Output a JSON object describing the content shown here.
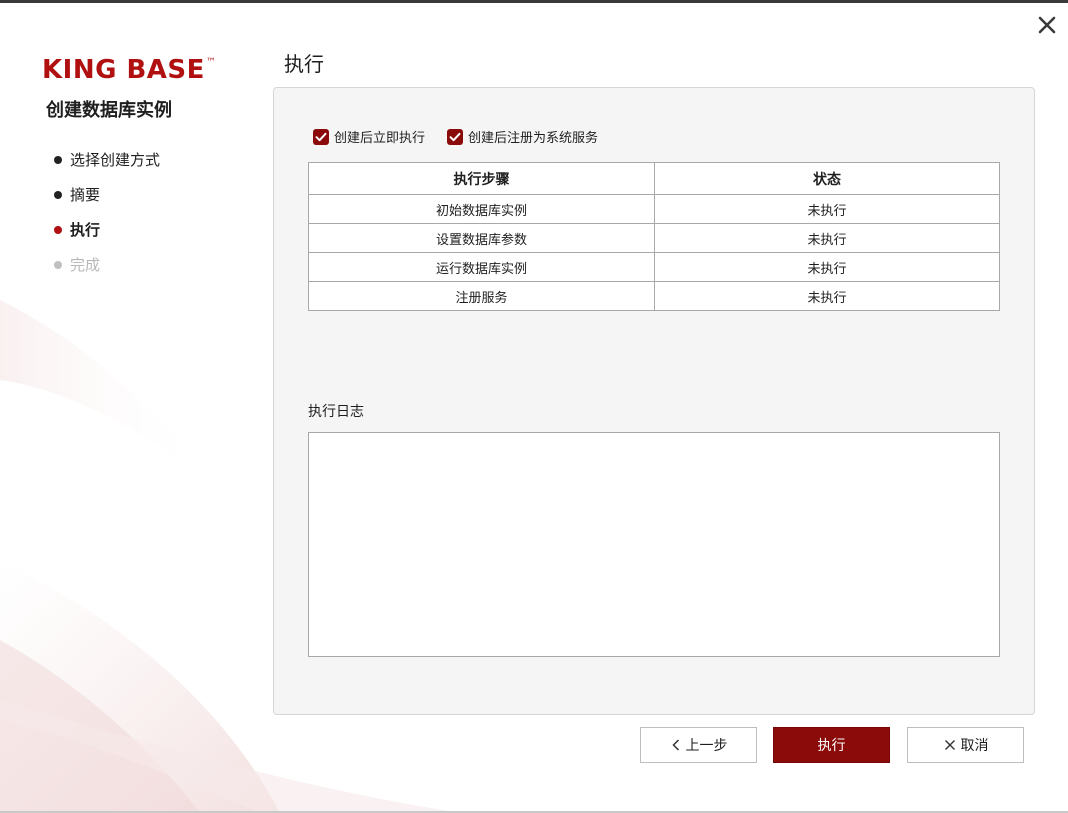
{
  "brand": {
    "logo_text": "KING BASE",
    "logo_tm": "™",
    "color": "#b01010"
  },
  "sidebar": {
    "title": "创建数据库实例",
    "steps": [
      {
        "label": "选择创建方式",
        "state": "done"
      },
      {
        "label": "摘要",
        "state": "done"
      },
      {
        "label": "执行",
        "state": "active"
      },
      {
        "label": "完成",
        "state": "pending"
      }
    ]
  },
  "page": {
    "title": "执行"
  },
  "options": [
    {
      "label": "创建后立即执行",
      "checked": true
    },
    {
      "label": "创建后注册为系统服务",
      "checked": true
    }
  ],
  "table": {
    "headers": [
      "执行步骤",
      "状态"
    ],
    "rows": [
      [
        "初始数据库实例",
        "未执行"
      ],
      [
        "设置数据库参数",
        "未执行"
      ],
      [
        "运行数据库实例",
        "未执行"
      ],
      [
        "注册服务",
        "未执行"
      ]
    ]
  },
  "log": {
    "label": "执行日志",
    "value": ""
  },
  "buttons": {
    "prev": "上一步",
    "execute": "执行",
    "cancel": "取消"
  },
  "colors": {
    "accent": "#8b0a0a",
    "active_dot": "#b01010",
    "panel_bg": "#f5f5f5"
  },
  "icons": {
    "close": "close-icon",
    "prev": "chevron-left-icon",
    "cancel": "x-icon",
    "check": "check-icon"
  }
}
